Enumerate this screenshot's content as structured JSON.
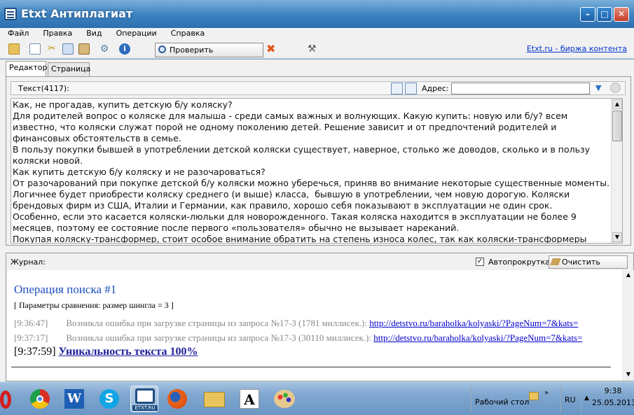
{
  "window": {
    "title": "Etxt Антиплагиат"
  },
  "menu": [
    "Файл",
    "Правка",
    "Вид",
    "Операции",
    "Справка"
  ],
  "toolbar": {
    "check_label": "Проверить уникальность",
    "link": "Etxt.ru - биржа контента"
  },
  "tabs": [
    {
      "label": "Редактор"
    },
    {
      "label": "Страница"
    }
  ],
  "editor": {
    "count_label": "Текст(4117):",
    "address_label": "Адрес:",
    "address_value": "",
    "text": "Как, не прогадав, купить детскую б/у коляску?\nДля родителей вопрос о коляске для малыша - среди самых важных и волнующих. Какую купить: новую или б/у? всем известно, что коляски служат порой не одному поколению детей. Решение зависит и от предпочтений родителей и финансовых обстоятельств в семье.\nВ пользу покупки бывшей в употреблении детской коляски существует, наверное, столько же доводов, сколько и в пользу коляски новой.\nКак купить детскую б/у коляску и не разочароваться?\nОт разочарований при покупке детской б/у коляски можно уберечься, приняв во внимание некоторые существенные моменты. Логичнее будет приобрести коляску среднего (и выше) класса,  бывшую в употреблении, чем новую дорогую. Коляски брендовых фирм из США, Италии и Германии, как правило, хорошо себя показывают в эксплуатации не один срок.\nОсобенно, если это касается коляски-люльки для новорожденного. Такая коляска находится в эксплуатации не более 9 месяцев, поэтому ее состояние после первого «пользователя» обычно не вызывает нареканий.\nПокупая коляску-трансформер, стоит особое внимание обратить на степень износа колес, так как коляски-трансформеры"
  },
  "log": {
    "label": "Журнал:",
    "autoscroll_label": "Автопрокрутка",
    "autoscroll_checked": "✓",
    "clear_label": "Очистить журнал",
    "op_title": "Операция поиска #1",
    "params": "[ Параметры сравнения: размер шингла = 3 ]",
    "lines": [
      {
        "time": "[9:36:47]",
        "msg": "Возникла ошибка при загрузке страницы из запроса №17-3 (1781 миллисек.):",
        "url": "http://detstvo.ru/baraholka/kolyaski/?PageNum=7&kats="
      },
      {
        "time": "[9:37:17]",
        "msg": "Возникла ошибка при загрузке страницы из запроса №17-3 (30110 миллисек.):",
        "url": "http://detstvo.ru/baraholka/kolyaski/?PageNum=7&kats="
      }
    ],
    "result_time": "[9:37:59]",
    "result_text": "Уникальность текста 100%"
  },
  "taskbar": {
    "desktop_label": "Рабочий стол",
    "lang": "RU",
    "time": "9:38",
    "date": "25.05.2013",
    "apps": [
      "opera-icon",
      "chrome-icon",
      "word-icon",
      "skype-icon",
      "etxt-icon",
      "firefox-icon",
      "explorer-icon",
      "font-icon",
      "paint-icon"
    ],
    "etxt_label": "ETXT.RU"
  },
  "colors": {
    "accent": "#1e4fbf",
    "title_bar": "#3f84c2",
    "close": "#c43a23"
  }
}
